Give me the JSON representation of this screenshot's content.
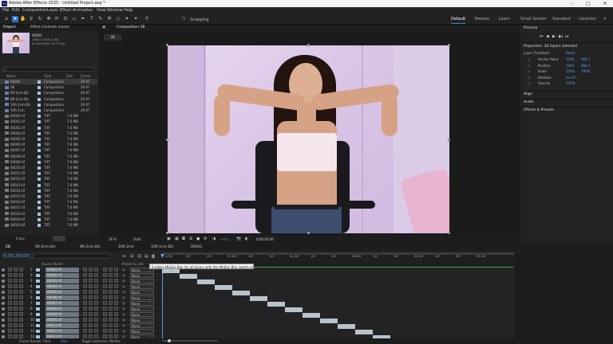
{
  "window": {
    "title": "Adobe After Effects 2025 - Untitled Project.aep *"
  },
  "menu": [
    "File",
    "Edit",
    "Composition",
    "Layer",
    "Effect",
    "Animation",
    "View",
    "Window",
    "Help"
  ],
  "toolbar": {
    "snapping_label": "Snapping"
  },
  "workspaces": [
    {
      "label": "Default",
      "active": true
    },
    {
      "label": "Review",
      "active": false
    },
    {
      "label": "Learn",
      "active": false
    },
    {
      "label": "Small Screen",
      "active": false
    },
    {
      "label": "Standard",
      "active": false
    },
    {
      "label": "Libraries",
      "active": false
    }
  ],
  "project_panel": {
    "tabs": [
      "Project",
      "Effect Controls (none)"
    ],
    "selected_item": {
      "name": "00001",
      "size": "1080 x 1920 (1.00)",
      "duration": "Δ 0;00;03;00, 29.97 fps"
    },
    "columns": [
      "Name",
      "Type",
      "Size",
      "Frame Ra..."
    ],
    "items": [
      {
        "name": "00001",
        "type": "Composition",
        "size": "",
        "rate": "29.97",
        "kind": "comp",
        "selected": true
      },
      {
        "name": "2B",
        "type": "Composition",
        "size": "",
        "rate": "29.97",
        "kind": "comp",
        "selected": false
      },
      {
        "name": "4R-2cm-Dlc",
        "type": "Composition",
        "size": "",
        "rate": "29.97",
        "kind": "comp",
        "selected": false
      },
      {
        "name": "8R-2cm-Dlc",
        "type": "Composition",
        "size": "",
        "rate": "29.97",
        "kind": "comp",
        "selected": false
      },
      {
        "name": "16R-2cm-Dlc",
        "type": "Composition",
        "size": "",
        "rate": "29.97",
        "kind": "comp",
        "selected": false
      },
      {
        "name": "10R-1cm",
        "type": "Composition",
        "size": "",
        "rate": "29.97",
        "kind": "comp",
        "selected": false
      },
      {
        "name": "00001.tif",
        "type": "TIFF",
        "size": "7.6 MB",
        "rate": "",
        "kind": "tiff",
        "selected": false
      },
      {
        "name": "00002.tif",
        "type": "TIFF",
        "size": "7.6 MB",
        "rate": "",
        "kind": "tiff",
        "selected": false
      },
      {
        "name": "00003.tif",
        "type": "TIFF",
        "size": "7.6 MB",
        "rate": "",
        "kind": "tiff",
        "selected": false
      },
      {
        "name": "00004.tif",
        "type": "TIFF",
        "size": "7.6 MB",
        "rate": "",
        "kind": "tiff",
        "selected": false
      },
      {
        "name": "00005.tif",
        "type": "TIFF",
        "size": "7.6 MB",
        "rate": "",
        "kind": "tiff",
        "selected": false
      },
      {
        "name": "00006.tif",
        "type": "TIFF",
        "size": "7.6 MB",
        "rate": "",
        "kind": "tiff",
        "selected": false
      },
      {
        "name": "00007.tif",
        "type": "TIFF",
        "size": "7.6 MB",
        "rate": "",
        "kind": "tiff",
        "selected": false
      },
      {
        "name": "00008.tif",
        "type": "TIFF",
        "size": "7.6 MB",
        "rate": "",
        "kind": "tiff",
        "selected": false
      },
      {
        "name": "00009.tif",
        "type": "TIFF",
        "size": "7.6 MB",
        "rate": "",
        "kind": "tiff",
        "selected": false
      },
      {
        "name": "00010.tif",
        "type": "TIFF",
        "size": "7.6 MB",
        "rate": "",
        "kind": "tiff",
        "selected": false
      },
      {
        "name": "00011.tif",
        "type": "TIFF",
        "size": "7.6 MB",
        "rate": "",
        "kind": "tiff",
        "selected": false
      },
      {
        "name": "00012.tif",
        "type": "TIFF",
        "size": "7.6 MB",
        "rate": "",
        "kind": "tiff",
        "selected": false
      },
      {
        "name": "00013.tif",
        "type": "TIFF",
        "size": "7.6 MB",
        "rate": "",
        "kind": "tiff",
        "selected": false
      },
      {
        "name": "00014.tif",
        "type": "TIFF",
        "size": "7.6 MB",
        "rate": "",
        "kind": "tiff",
        "selected": false
      },
      {
        "name": "00015.tif",
        "type": "TIFF",
        "size": "7.6 MB",
        "rate": "",
        "kind": "tiff",
        "selected": false
      },
      {
        "name": "00016.tif",
        "type": "TIFF",
        "size": "7.6 MB",
        "rate": "",
        "kind": "tiff",
        "selected": false
      },
      {
        "name": "00017.tif",
        "type": "TIFF",
        "size": "7.6 MB",
        "rate": "",
        "kind": "tiff",
        "selected": false
      },
      {
        "name": "00018.tif",
        "type": "TIFF",
        "size": "7.6 MB",
        "rate": "",
        "kind": "tiff",
        "selected": false
      },
      {
        "name": "00019.tif",
        "type": "TIFF",
        "size": "7.6 MB",
        "rate": "",
        "kind": "tiff",
        "selected": false
      },
      {
        "name": "00020.tif",
        "type": "TIFF",
        "size": "7.6 MB",
        "rate": "",
        "kind": "tiff",
        "selected": false
      }
    ],
    "bpc_label": "8 bpc"
  },
  "composition_panel": {
    "tab": "Composition 2B",
    "flow_tab": "2B",
    "zoom": "16 %",
    "resolution": "(Full)",
    "timecode": "0;00;00;00",
    "exposure": "+0.0"
  },
  "preview_panel": {
    "title": "Preview"
  },
  "properties_panel": {
    "title": "Properties: 20 layers selected",
    "layer_transform": "Layer Transform",
    "reset": "Reset",
    "rows": [
      {
        "label": "Anchor Point",
        "v1": "1000",
        "v2": "666.7"
      },
      {
        "label": "Position",
        "v1": "1000",
        "v2": "666.7"
      },
      {
        "label": "Scale",
        "v1": "100%",
        "v2": "100%"
      },
      {
        "label": "Rotation",
        "v1": "0x+0°",
        "v2": ""
      },
      {
        "label": "Opacity",
        "v1": "100%",
        "v2": ""
      }
    ],
    "sections": [
      "Align",
      "Audio",
      "Effects & Presets"
    ]
  },
  "timeline": {
    "tabs": [
      "2B",
      "4R-2cm-Dlc",
      "8R-2cm-Dlc",
      "16R-2cm",
      "10R-1cm-Dlc",
      "00001"
    ],
    "timecode": "0;00;00;00",
    "search_placeholder": "",
    "columns": {
      "source": "Source Name",
      "parent": "Parent & Link"
    },
    "ruler": [
      "0;00f",
      "10f",
      "20f",
      "01;00f",
      "10f",
      "20f",
      "02;00f",
      "10f",
      "20f",
      "03;00f",
      "10f",
      "20f",
      "04;00f",
      "10f",
      "20f",
      "05;00f"
    ],
    "tooltip": "Enables Motion Blur for all layers with the Motion Blur switch set",
    "parent_value": "None",
    "layers": [
      {
        "num": "1",
        "name": "00001.tif"
      },
      {
        "num": "2",
        "name": "00002.tif"
      },
      {
        "num": "3",
        "name": "00003.tif"
      },
      {
        "num": "4",
        "name": "00004.tif"
      },
      {
        "num": "5",
        "name": "00005.tif"
      },
      {
        "num": "6",
        "name": "00006.tif"
      },
      {
        "num": "7",
        "name": "00007.tif"
      },
      {
        "num": "8",
        "name": "00008.tif"
      },
      {
        "num": "9",
        "name": "00009.tif"
      },
      {
        "num": "10",
        "name": "00010.tif"
      },
      {
        "num": "11",
        "name": "00011.tif"
      },
      {
        "num": "12",
        "name": "00012.tif"
      },
      {
        "num": "13",
        "name": "00013.tif"
      }
    ],
    "status": {
      "render_label": "Frame Render Time:",
      "render_value": "0ms",
      "toggle": "Toggle Switches / Modes"
    }
  }
}
